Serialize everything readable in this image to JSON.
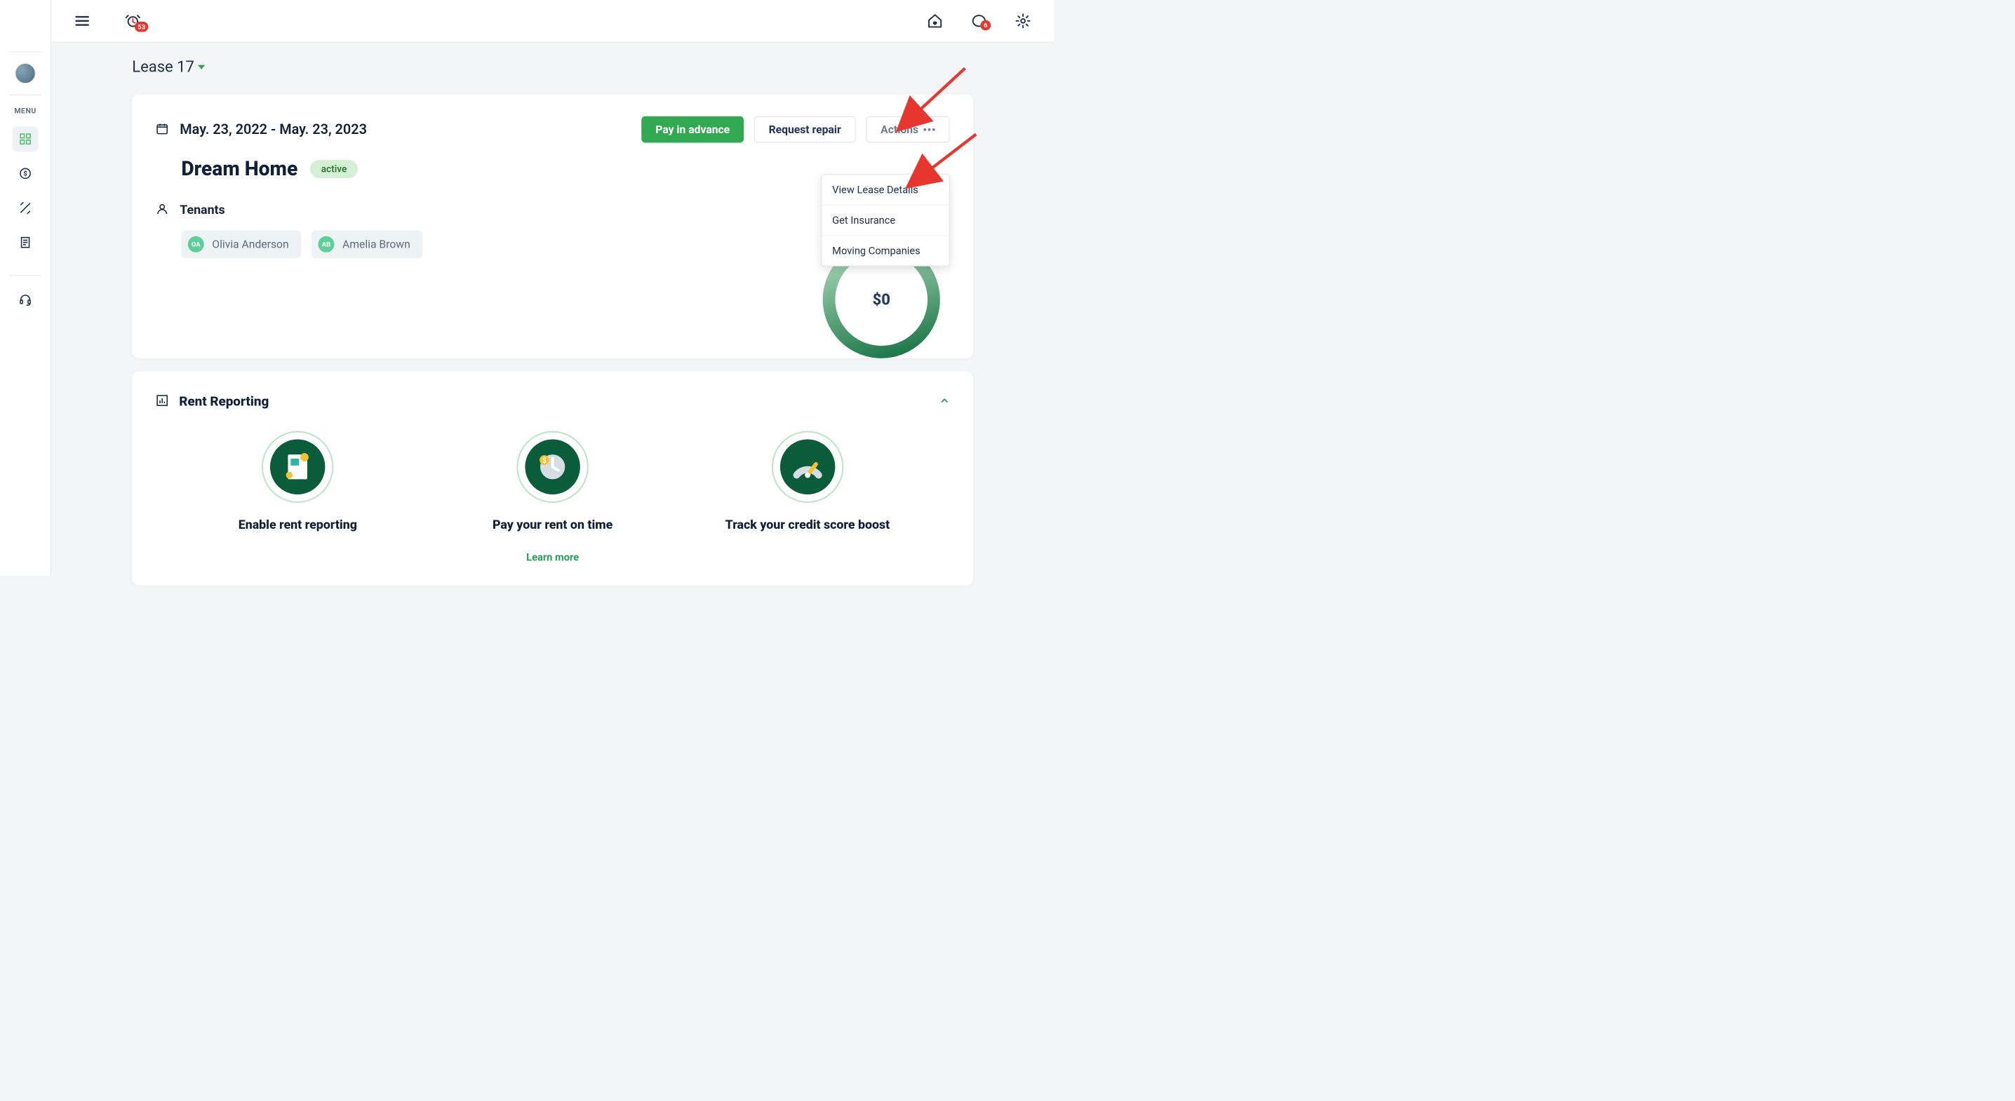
{
  "header": {
    "alarm_badge": "53",
    "chat_badge": "6"
  },
  "sidebar": {
    "menu_label": "MENU"
  },
  "lease": {
    "breadcrumb": "Lease 17",
    "date_range": "May. 23, 2022 - May. 23, 2023",
    "property_name": "Dream Home",
    "status": "active",
    "tenants_label": "Tenants",
    "tenants": [
      {
        "initials": "OA",
        "name": "Olivia Anderson"
      },
      {
        "initials": "AB",
        "name": "Amelia Brown"
      }
    ],
    "balance": "$0",
    "buttons": {
      "pay_in_advance": "Pay in advance",
      "request_repair": "Request repair",
      "actions": "Actions"
    },
    "actions_menu": [
      "View Lease Details",
      "Get Insurance",
      "Moving Companies"
    ]
  },
  "rent_reporting": {
    "title": "Rent Reporting",
    "columns": [
      "Enable rent reporting",
      "Pay your rent on time",
      "Track your credit score boost"
    ],
    "learn_more": "Learn more"
  }
}
